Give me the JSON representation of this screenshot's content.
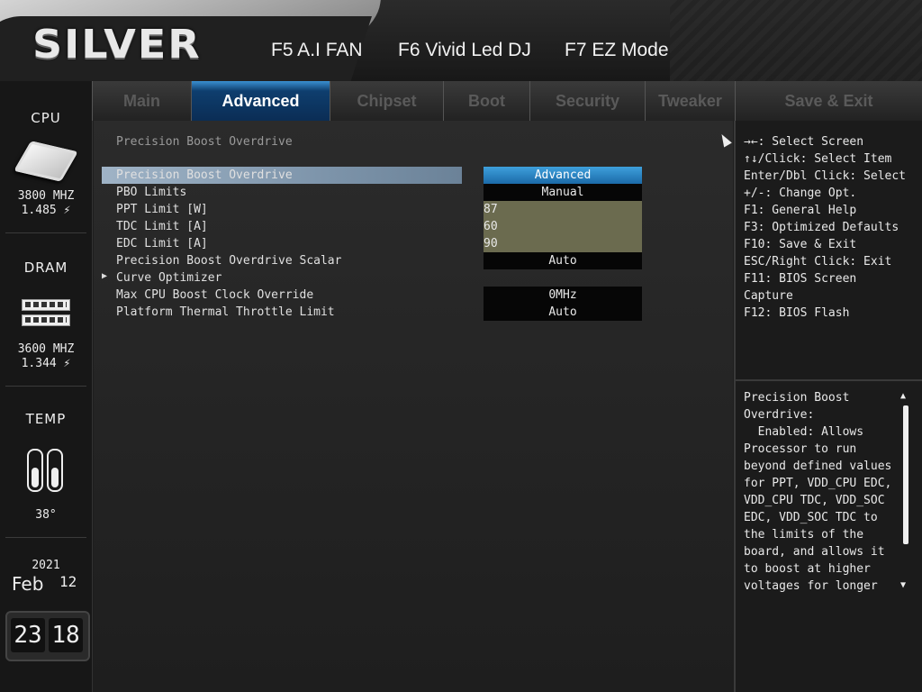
{
  "header": {
    "logo": "SILVER",
    "hotkeys": [
      "F5 A.I FAN",
      "F6 Vivid Led DJ",
      "F7 EZ Mode"
    ]
  },
  "sidebar": {
    "cpu": {
      "title": "CPU",
      "freq": "3800 MHZ",
      "volt": "1.485 ⚡"
    },
    "dram": {
      "title": "DRAM",
      "freq": "3600 MHZ",
      "volt": "1.344 ⚡"
    },
    "temp": {
      "title": "TEMP",
      "value": "38°"
    },
    "date": {
      "year": "2021",
      "month": "Feb",
      "day": "12"
    },
    "time": {
      "hour": "23",
      "minute": "18"
    }
  },
  "tabs": [
    "Main",
    "Advanced",
    "Chipset",
    "Boot",
    "Security",
    "Tweaker",
    "Save & Exit"
  ],
  "active_tab": "Advanced",
  "page_title": "Precision Boost Overdrive",
  "rows": [
    {
      "label": "Precision Boost Overdrive",
      "value": "Advanced",
      "selected": true
    },
    {
      "label": "PBO Limits",
      "value": "Manual"
    },
    {
      "label": "PPT Limit [W]",
      "value": "87",
      "numeric": true
    },
    {
      "label": "TDC Limit [A]",
      "value": "60",
      "numeric": true
    },
    {
      "label": "EDC Limit [A]",
      "value": "90",
      "numeric": true
    },
    {
      "label": "Precision Boost Overdrive Scalar",
      "value": "Auto"
    },
    {
      "label": "Curve Optimizer",
      "submenu": true
    },
    {
      "label": "Max CPU Boost Clock Override",
      "value": "0MHz"
    },
    {
      "label": "Platform Thermal Throttle Limit",
      "value": "Auto"
    }
  ],
  "keys": [
    "→←: Select Screen",
    "↑↓/Click: Select Item",
    "Enter/Dbl Click: Select",
    "+/-: Change Opt.",
    "F1: General Help",
    "F3: Optimized Defaults",
    "F10: Save & Exit",
    "ESC/Right Click: Exit",
    "F11: BIOS Screen",
    "Capture",
    "F12: BIOS Flash"
  ],
  "help": "Precision Boost\nOverdrive:\n  Enabled: Allows\nProcessor to run\nbeyond defined values\nfor PPT, VDD_CPU EDC,\nVDD_CPU TDC, VDD_SOC\nEDC, VDD_SOC TDC to\nthe limits of the\nboard, and allows it\nto boost at higher\nvoltages for longer"
}
